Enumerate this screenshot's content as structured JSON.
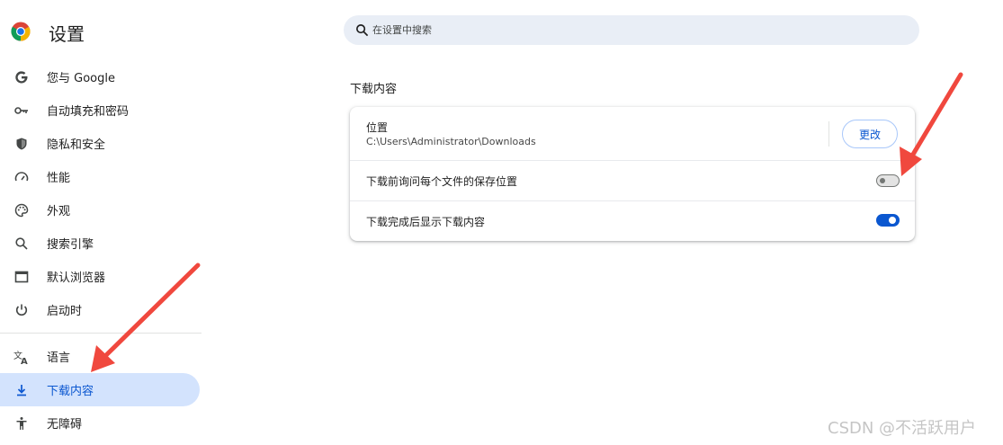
{
  "header": {
    "app_title": "设置",
    "search_placeholder": "在设置中搜索"
  },
  "sidebar": {
    "items": [
      {
        "label": "您与 Google",
        "icon": "google-g-icon"
      },
      {
        "label": "自动填充和密码",
        "icon": "key-icon"
      },
      {
        "label": "隐私和安全",
        "icon": "shield-icon"
      },
      {
        "label": "性能",
        "icon": "speedometer-icon"
      },
      {
        "label": "外观",
        "icon": "palette-icon"
      },
      {
        "label": "搜索引擎",
        "icon": "search-icon"
      },
      {
        "label": "默认浏览器",
        "icon": "browser-window-icon"
      },
      {
        "label": "启动时",
        "icon": "power-icon"
      },
      {
        "label": "语言",
        "icon": "translate-icon"
      },
      {
        "label": "下载内容",
        "icon": "download-icon",
        "selected": true
      },
      {
        "label": "无障碍",
        "icon": "accessibility-icon"
      }
    ]
  },
  "main": {
    "section_title": "下载内容",
    "location": {
      "title": "位置",
      "path": "C:\\Users\\Administrator\\Downloads",
      "change_label": "更改"
    },
    "ask_where_to_save": {
      "label": "下载前询问每个文件的保存位置",
      "enabled": false
    },
    "show_downloads_when_done": {
      "label": "下载完成后显示下载内容",
      "enabled": true
    }
  },
  "watermark": "CSDN @不活跃用户",
  "colors": {
    "accent": "#0b57d0",
    "selected_bg": "#d3e3fd",
    "search_bg": "#e9eef6",
    "arrow": "#f0483e"
  }
}
